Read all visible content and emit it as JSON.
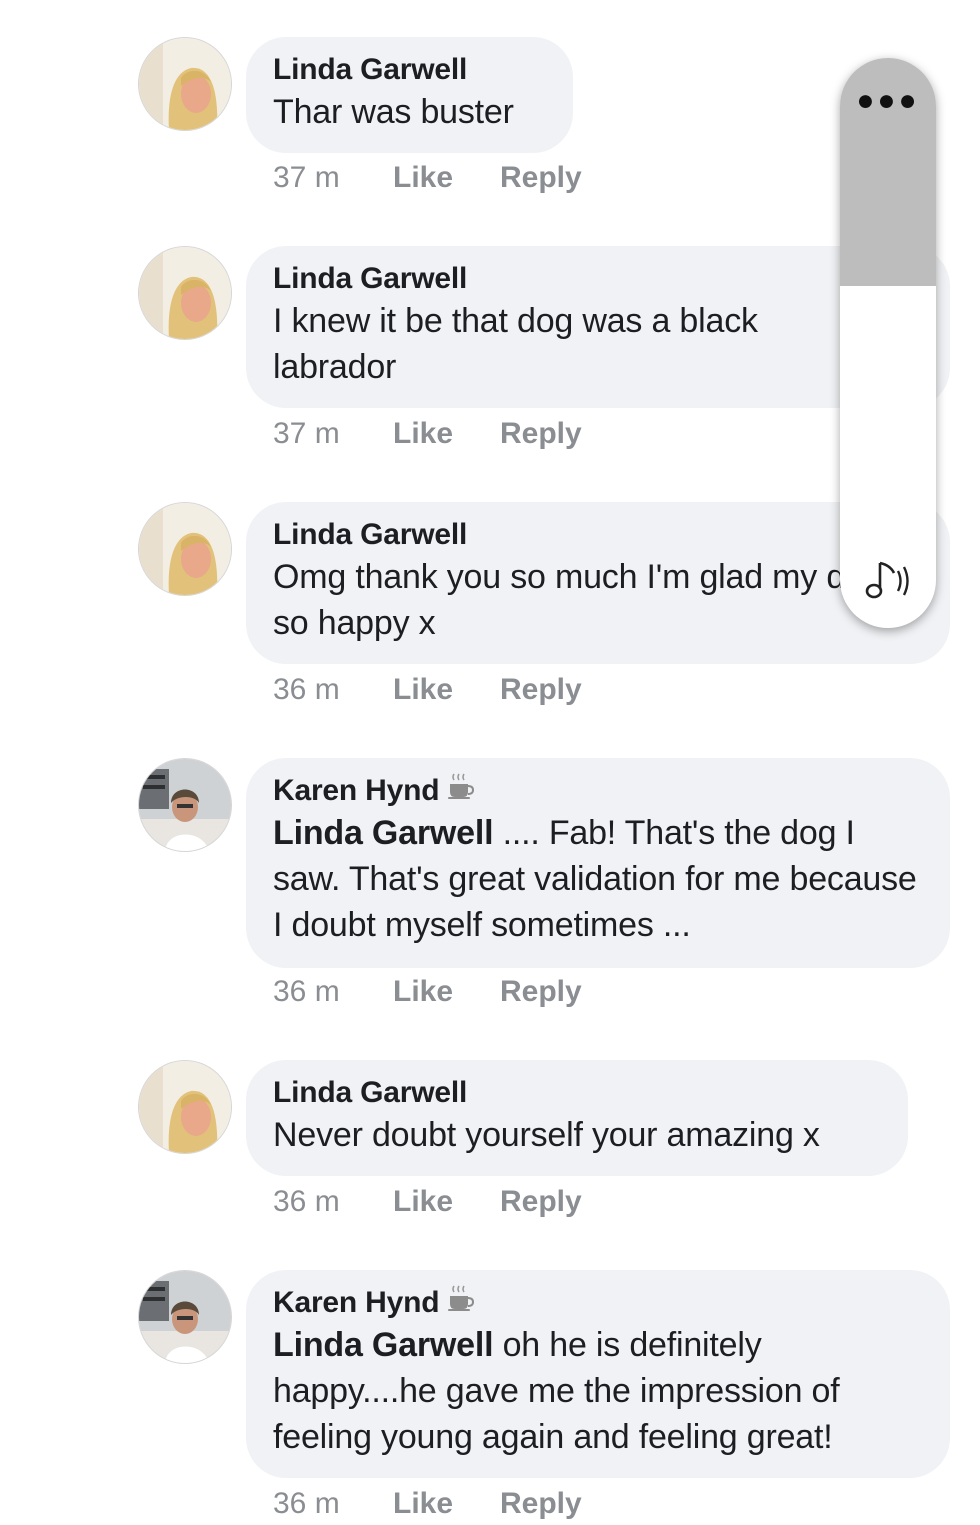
{
  "comments": [
    {
      "author": "Linda Garwell",
      "text": "Thar was buster",
      "time": "37 m",
      "like": "Like",
      "reply": "Reply"
    },
    {
      "author": "Linda Garwell",
      "text": "I knew it be that dog was a black labrador",
      "time": "37 m",
      "like": "Like",
      "reply": "Reply"
    },
    {
      "author": "Linda Garwell",
      "text": "Omg thank you so much I'm glad my dad so happy  x",
      "time": "36 m",
      "like": "Like",
      "reply": "Reply"
    },
    {
      "author": "Karen Hynd",
      "author_icon": "coffee-cup-icon",
      "mention": "Linda Garwell",
      "text": " .... Fab! That's the dog I saw. That's great validation for me because I doubt myself sometimes ...",
      "time": "36 m",
      "like": "Like",
      "reply": "Reply"
    },
    {
      "author": "Linda Garwell",
      "text": "Never doubt yourself your amazing x",
      "time": "36 m",
      "like": "Like",
      "reply": "Reply"
    },
    {
      "author": "Karen Hynd",
      "author_icon": "coffee-cup-icon",
      "mention": "Linda Garwell",
      "text": " oh he is definitely happy....he gave me the impression of feeling young again and feeling great!",
      "time": "36 m",
      "like": "Like",
      "reply": "Reply"
    }
  ],
  "volume_overlay": {
    "menu_icon": "more-dots-icon",
    "media_icon": "music-note-volume-icon",
    "level": 0.6
  },
  "colors": {
    "bubble": "#f0f2f5",
    "meta_text": "#8a8d91",
    "volume_fill": "#bdbdbd"
  }
}
